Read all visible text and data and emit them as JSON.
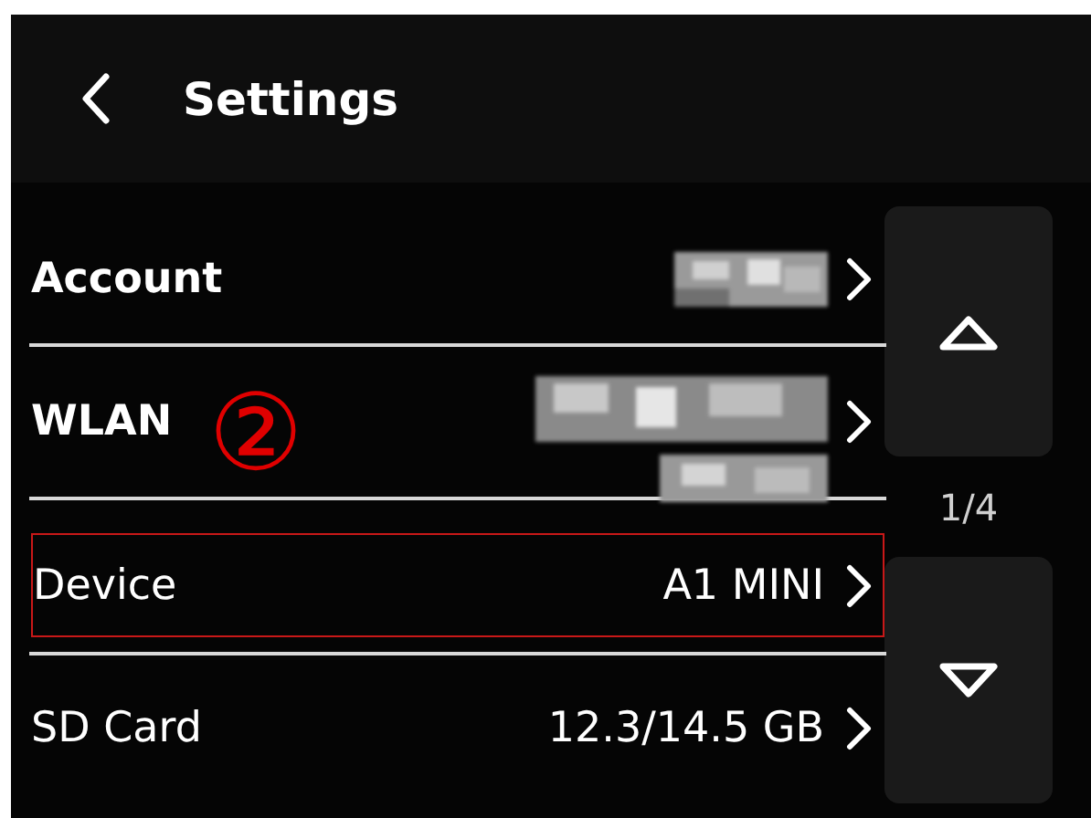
{
  "header": {
    "title": "Settings"
  },
  "rows": [
    {
      "label": "Account",
      "kind": "redacted-short",
      "highlighted": false
    },
    {
      "label": "WLAN",
      "kind": "redacted-two-line",
      "highlighted": false
    },
    {
      "label": "Device",
      "kind": "text",
      "value": "A1 MINI",
      "highlighted": true
    },
    {
      "label": "SD Card",
      "kind": "text",
      "value": "12.3/14.5 GB",
      "highlighted": false
    }
  ],
  "pager": {
    "page": "1/4"
  },
  "annotation": {
    "text": "②"
  }
}
